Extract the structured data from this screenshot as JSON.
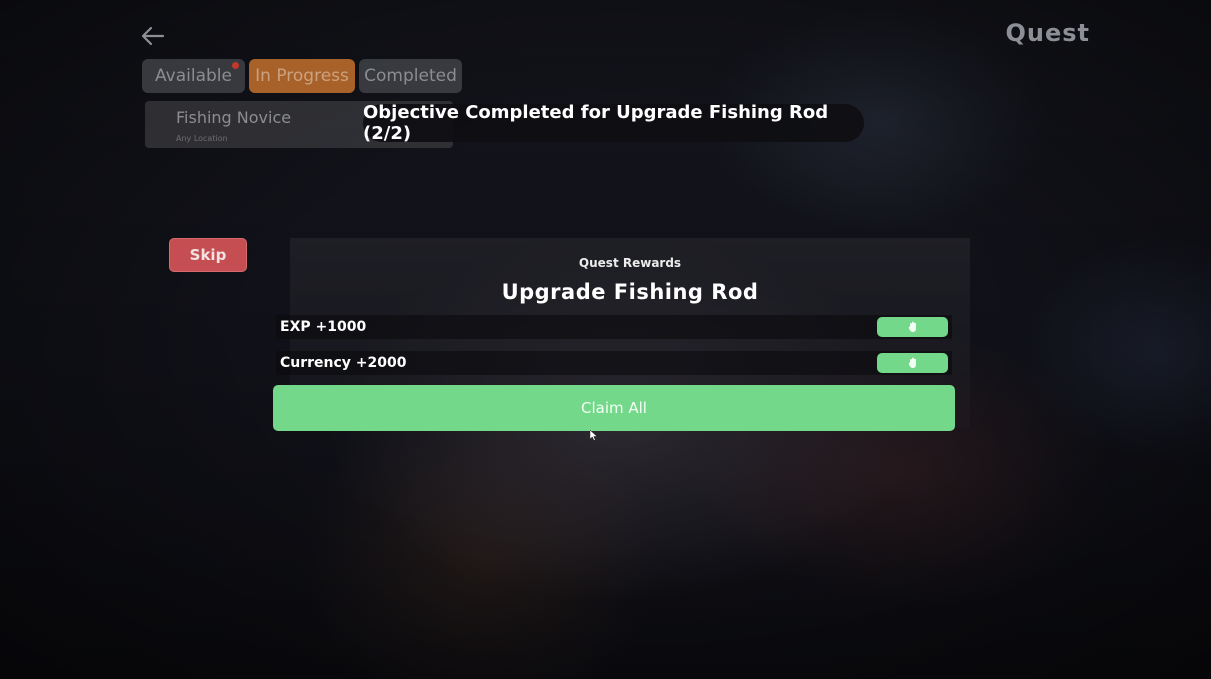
{
  "header": {
    "title": "Quest",
    "back_icon": "arrow-left-icon"
  },
  "tabs": [
    {
      "label": "Available",
      "notification": true
    },
    {
      "label": "In Progress",
      "active": true
    },
    {
      "label": "Completed"
    }
  ],
  "quest_list": [
    {
      "name": "Fishing Novice",
      "location": "Any Location"
    }
  ],
  "toast": {
    "message": "Objective Completed for Upgrade Fishing Rod (2/2)"
  },
  "skip_button": {
    "label": "Skip"
  },
  "rewards": {
    "heading": "Quest Rewards",
    "quest_title": "Upgrade Fishing Rod",
    "items": [
      {
        "label": "EXP +1000",
        "claim_icon": "hand-icon"
      },
      {
        "label": "Currency +2000",
        "claim_icon": "hand-icon"
      }
    ],
    "claim_all_label": "Claim All"
  },
  "colors": {
    "accent_green": "#74d88a",
    "skip_red": "#c44e52",
    "tab_active": "#a9612a"
  }
}
